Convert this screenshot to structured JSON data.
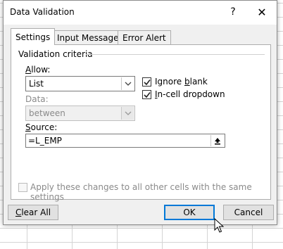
{
  "dialog": {
    "title": "Data Validation",
    "help_symbol": "?",
    "close_symbol": "✕"
  },
  "tabs": [
    {
      "label": "Settings",
      "active": true
    },
    {
      "label": "Input Message",
      "active": false
    },
    {
      "label": "Error Alert",
      "active": false
    }
  ],
  "criteria": {
    "group_label": "Validation criteria",
    "allow": {
      "label": "Allow:",
      "value": "List"
    },
    "data": {
      "label": "Data:",
      "value": "between",
      "disabled": true
    },
    "ignore_blank": {
      "label": "Ignore blank",
      "checked": true
    },
    "in_cell_dropdown": {
      "label": "In-cell dropdown",
      "checked": true
    },
    "source": {
      "label": "Source:",
      "value": "=L_EMP"
    }
  },
  "apply_all": {
    "label": "Apply these changes to all other cells with the same settings",
    "checked": false,
    "disabled": true
  },
  "buttons": {
    "clear_all": "Clear All",
    "ok": "OK",
    "cancel": "Cancel"
  }
}
